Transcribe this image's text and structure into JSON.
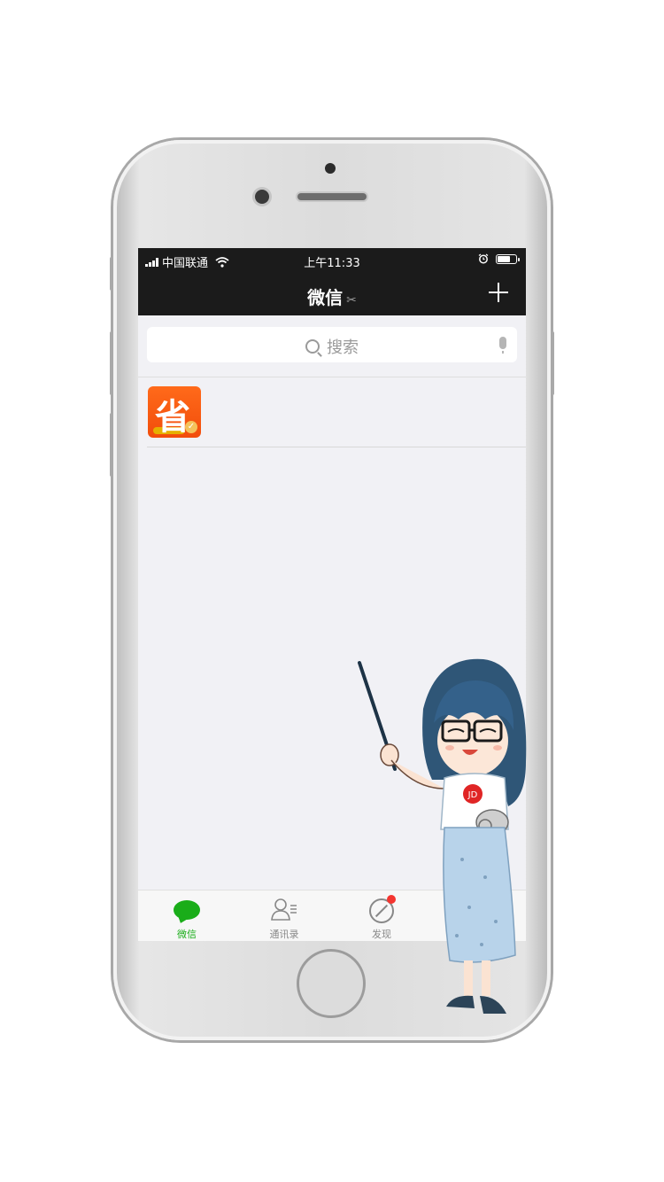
{
  "status_bar": {
    "carrier": "中国联通",
    "time": "上午11:33",
    "battery_level": 0.7,
    "icons": [
      "signal-icon",
      "wifi-icon",
      "alarm-icon",
      "battery-icon"
    ]
  },
  "nav_bar": {
    "title": "微信",
    "title_icon": "ear-icon",
    "action_icon": "plus-icon"
  },
  "search": {
    "placeholder": "搜索",
    "icons": [
      "search-icon",
      "mic-icon"
    ]
  },
  "chat_list": [
    {
      "avatar_text": "省",
      "avatar_icon": "app-logo-icon",
      "has_badge_check": true
    }
  ],
  "tab_bar": {
    "tabs": [
      {
        "label": "微信",
        "icon": "chat-bubble-icon",
        "active": true
      },
      {
        "label": "通讯录",
        "icon": "contacts-icon",
        "active": false
      },
      {
        "label": "发现",
        "icon": "compass-icon",
        "active": false,
        "has_red_dot": true
      }
    ],
    "active_color": "#1aad19"
  },
  "mascot": {
    "badge_text": "JD"
  },
  "colors": {
    "header_bg": "#1b1b1b",
    "app_avatar": "#f24d0b",
    "screen_bg": "#f1f1f5"
  }
}
